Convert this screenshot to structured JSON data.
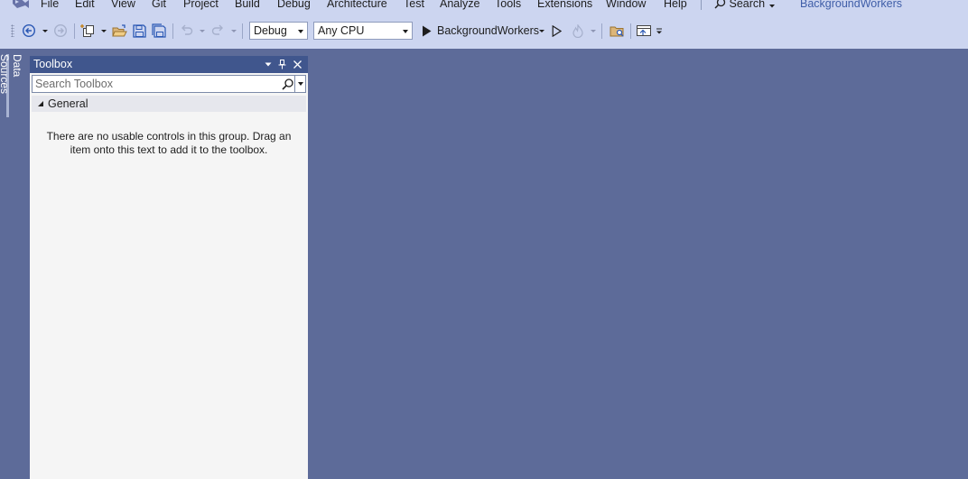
{
  "menu": {
    "items": [
      "File",
      "Edit",
      "View",
      "Git",
      "Project",
      "Build",
      "Debug",
      "Architecture",
      "Test",
      "Analyze",
      "Tools",
      "Extensions",
      "Window",
      "Help"
    ],
    "search_label": "Search",
    "solution_name": "BackgroundWorkers"
  },
  "toolbar": {
    "configuration": "Debug",
    "platform": "Any CPU",
    "startup_project": "BackgroundWorkers"
  },
  "side_tabs": {
    "data_sources": "Data Sources"
  },
  "toolbox": {
    "title": "Toolbox",
    "search_placeholder": "Search Toolbox",
    "group_name": "General",
    "empty_message": "There are no usable controls in this group. Drag an item onto this text to add it to the toolbox."
  },
  "colors": {
    "chrome": "#ccd5f0",
    "workspace": "#5d6b99",
    "panel_header": "#40568d",
    "panel_body": "#f5f5f5",
    "accent_text": "#3f5ea8"
  }
}
